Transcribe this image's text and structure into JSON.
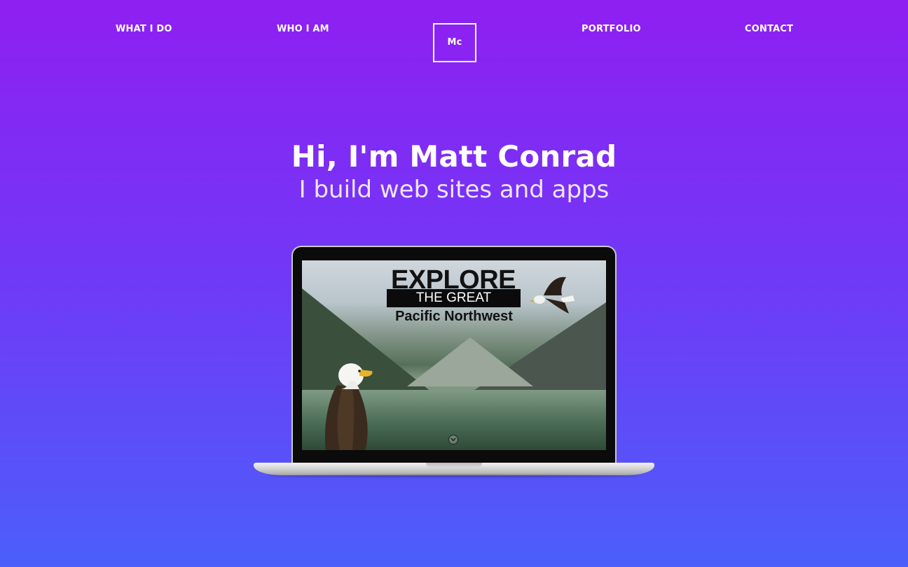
{
  "nav": {
    "items": [
      {
        "label": "WHAT I DO"
      },
      {
        "label": "WHO I AM"
      },
      {
        "label": "PORTFOLIO"
      },
      {
        "label": "CONTACT"
      }
    ],
    "logo_text": "Mc"
  },
  "hero": {
    "title": "Hi, I'm Matt Conrad",
    "subtitle": "I build web sites and apps"
  },
  "laptop_screen": {
    "line1": "EXPLORE",
    "line2": "THE GREAT",
    "line3": "Pacific Northwest",
    "scroll_icon": "chevron-down-circle-icon"
  },
  "colors": {
    "gradient_top": "#8f1ff2",
    "gradient_bottom": "#4b5ffa",
    "text": "#ffffff"
  }
}
